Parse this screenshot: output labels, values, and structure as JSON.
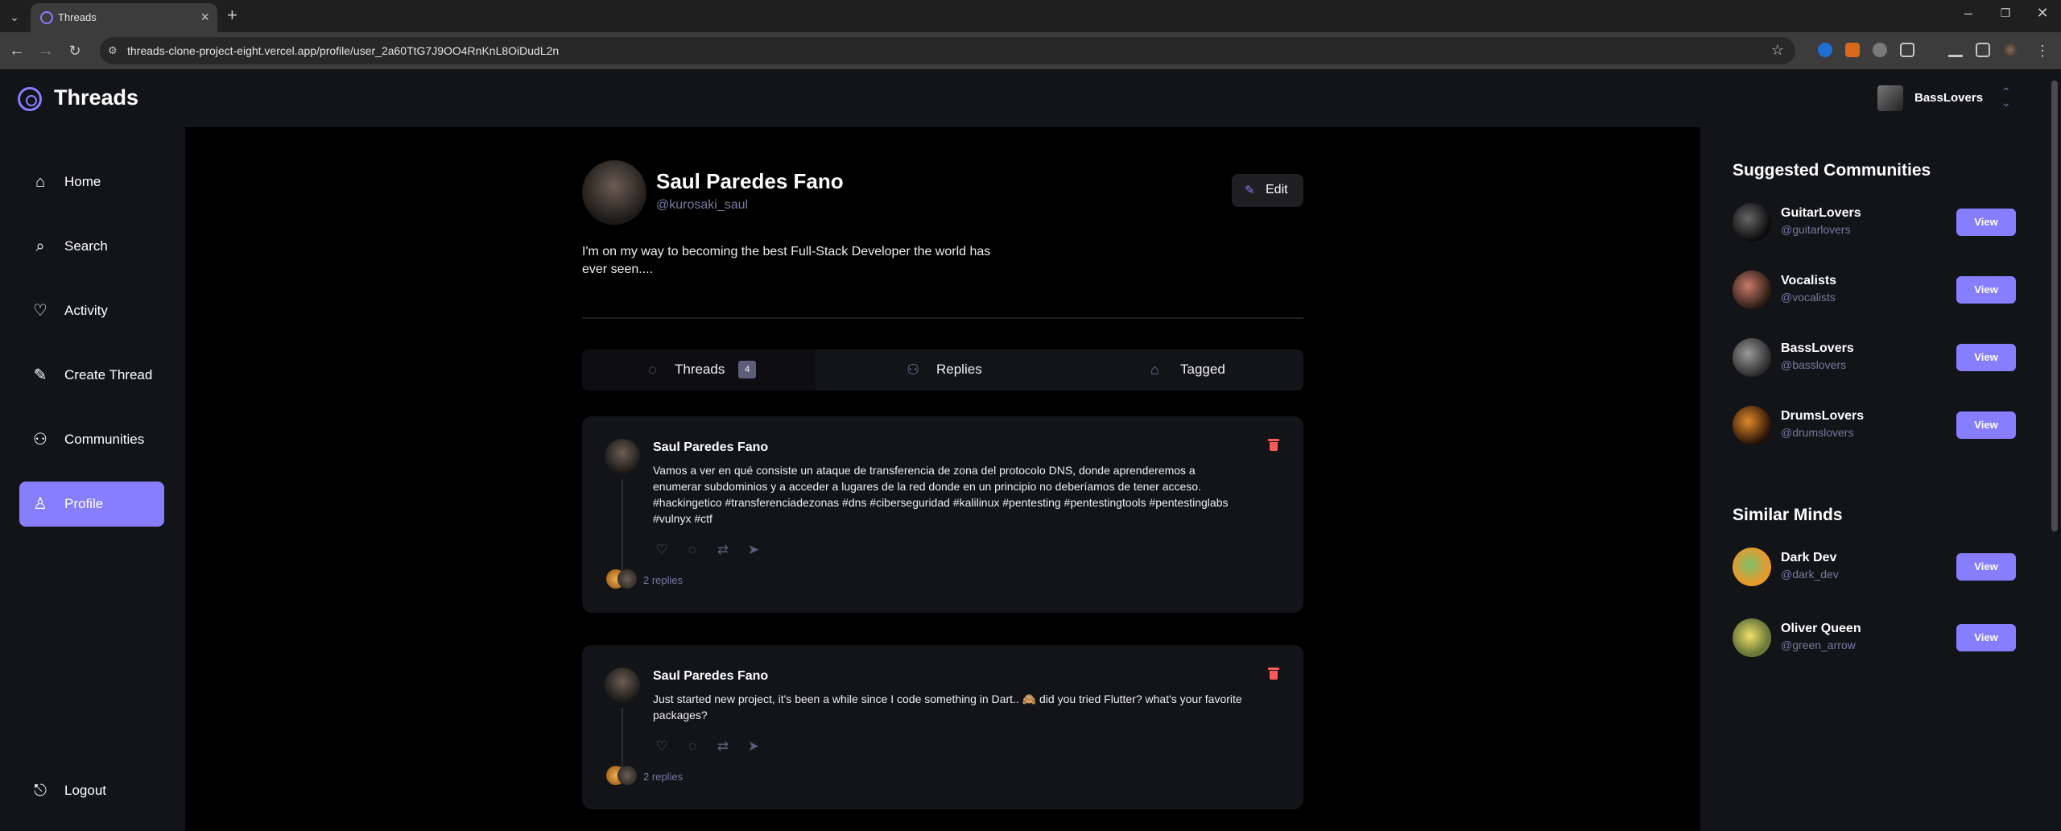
{
  "browser": {
    "tab_title": "Threads",
    "url": "threads-clone-project-eight.vercel.app/profile/user_2a60TtG7J9OO4RnKnL8OiDudL2n"
  },
  "app": {
    "logo_text": "Threads",
    "org_name": "BassLovers"
  },
  "sidebar": {
    "items": [
      {
        "label": "Home",
        "icon": "home-icon"
      },
      {
        "label": "Search",
        "icon": "search-icon"
      },
      {
        "label": "Activity",
        "icon": "heart-icon"
      },
      {
        "label": "Create Thread",
        "icon": "create-icon"
      },
      {
        "label": "Communities",
        "icon": "communities-icon"
      },
      {
        "label": "Profile",
        "icon": "user-icon",
        "active": true
      }
    ],
    "logout_label": "Logout"
  },
  "profile": {
    "name": "Saul Paredes Fano",
    "handle": "@kurosaki_saul",
    "edit_label": "Edit",
    "bio": "I'm on my way to becoming the best Full-Stack Developer the world has ever seen...."
  },
  "tabs": [
    {
      "label": "Threads",
      "count": "4",
      "active": true
    },
    {
      "label": "Replies"
    },
    {
      "label": "Tagged"
    }
  ],
  "threads": [
    {
      "author": "Saul Paredes Fano",
      "content": "Vamos a ver en qué consiste un ataque de transferencia de zona del protocolo DNS, donde aprenderemos a enumerar subdominios y a acceder a lugares de la red donde en un principio no deberíamos de tener acceso. #hackingetico #transferenciadezonas #dns #ciberseguridad #kalilinux #pentesting #pentestingtools #pentestinglabs #vulnyx #ctf",
      "replies": "2 replies"
    },
    {
      "author": "Saul Paredes Fano",
      "content": "Just started new project, it's been a while since I code something in Dart.. 🙈 did you tried Flutter? what's your favorite packages?",
      "replies": "2 replies"
    }
  ],
  "suggested_communities": {
    "title": "Suggested Communities",
    "view_label": "View",
    "items": [
      {
        "name": "GuitarLovers",
        "handle": "@guitarlovers"
      },
      {
        "name": "Vocalists",
        "handle": "@vocalists"
      },
      {
        "name": "BassLovers",
        "handle": "@basslovers"
      },
      {
        "name": "DrumsLovers",
        "handle": "@drumslovers"
      }
    ]
  },
  "similar_minds": {
    "title": "Similar Minds",
    "view_label": "View",
    "items": [
      {
        "name": "Dark Dev",
        "handle": "@dark_dev"
      },
      {
        "name": "Oliver Queen",
        "handle": "@green_arrow"
      }
    ]
  },
  "colors": {
    "accent": "#877eff",
    "panel": "#121417",
    "muted": "#7878a3",
    "danger": "#ff5a5a"
  }
}
